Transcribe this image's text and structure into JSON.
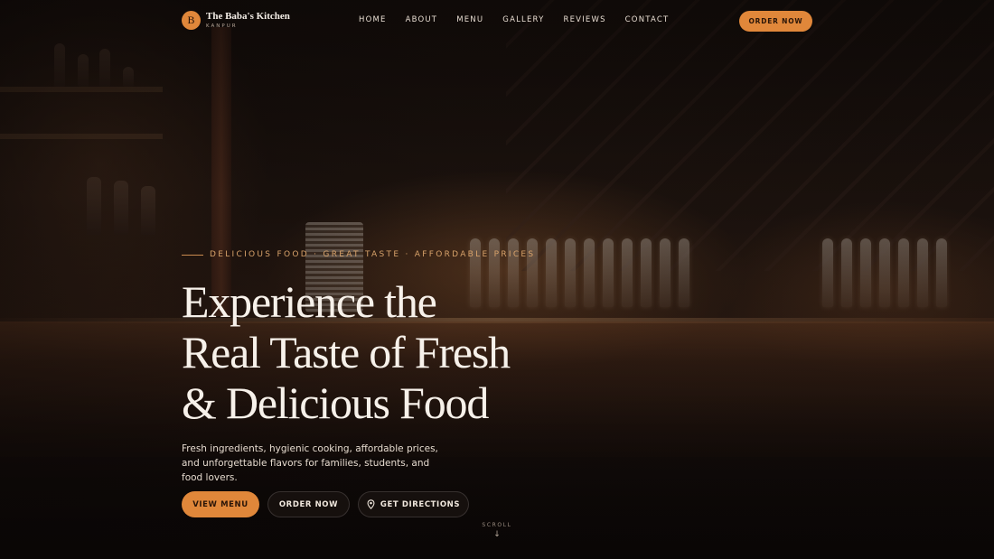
{
  "brand": {
    "badge_letter": "B",
    "name": "The Baba's Kitchen",
    "city": "KANPUR",
    "accent": "#e0873a"
  },
  "nav": {
    "items": [
      {
        "label": "HOME"
      },
      {
        "label": "ABOUT"
      },
      {
        "label": "MENU"
      },
      {
        "label": "GALLERY"
      },
      {
        "label": "REVIEWS"
      },
      {
        "label": "CONTACT"
      }
    ],
    "order_label": "ORDER NOW"
  },
  "hero": {
    "eyebrow": "DELICIOUS FOOD · GREAT TASTE · AFFORDABLE PRICES",
    "headline": [
      "Experience the",
      "Real Taste of Fresh",
      "& Delicious Food"
    ],
    "subcopy": "Fresh ingredients, hygienic cooking, affordable prices, and unforgettable flavors for families, students, and food lovers.",
    "buttons": {
      "view_menu": "VIEW MENU",
      "order_now": "ORDER NOW",
      "directions": "GET DIRECTIONS",
      "directions_icon": "map-pin-icon"
    },
    "scroll_label": "SCROLL",
    "scroll_icon": "arrow-down-icon"
  }
}
